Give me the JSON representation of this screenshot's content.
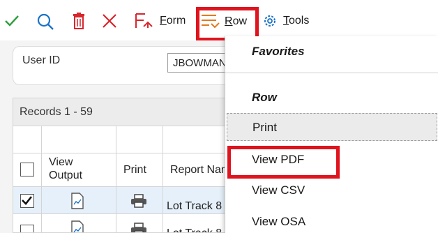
{
  "toolbar": {
    "form_label": "Form",
    "row_label": "Row",
    "tools_label": "Tools"
  },
  "form": {
    "user_id_label": "User ID",
    "user_id_value": "JBOWMAN"
  },
  "grid": {
    "records": "Records 1 - 59",
    "columns": {
      "view_output": "View Output",
      "print": "Print",
      "report_name": "Report Name"
    },
    "rows": [
      {
        "selected": true,
        "report_name": "Lot Track 8"
      },
      {
        "selected": false,
        "report_name": "Lot Track 8"
      }
    ]
  },
  "row_menu": {
    "favorites_header": "Favorites",
    "row_header": "Row",
    "items": [
      "Print",
      "View PDF",
      "View CSV",
      "View OSA"
    ]
  },
  "colors": {
    "highlight_red": "#e0141e",
    "check_green": "#2e9e3e",
    "icon_blue": "#1a73c8",
    "delete_red": "#d8262c"
  }
}
